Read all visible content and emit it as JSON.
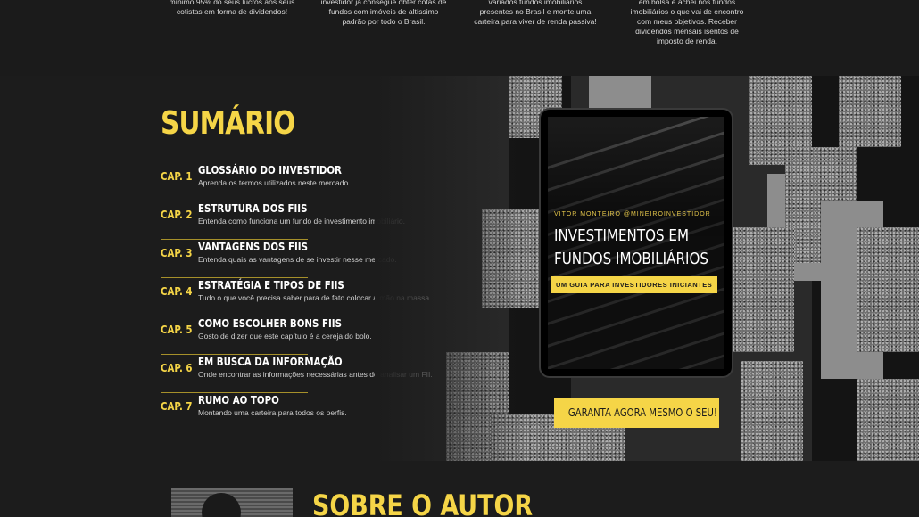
{
  "top_columns": [
    {
      "lines": [
        "mínimo 95% do seus lucros aos seus",
        "cotistas em forma de dividendos!"
      ]
    },
    {
      "lines": [
        "investidor já consegue obter cotas de",
        "fundos com imóveis de altíssimo",
        "padrão por todo o Brasil."
      ]
    },
    {
      "lines": [
        "variados fundos imobiliários",
        "presentes no Brasil e monte uma",
        "carteira para viver de renda passiva!"
      ]
    },
    {
      "lines": [
        "em bolsa e achei nos fundos",
        "imobiliários o que vai de encontro",
        "com meus objetivos. Receber",
        "dividendos mensais isentos de",
        "imposto de renda."
      ]
    }
  ],
  "sumario": {
    "title": "SUMÁRIO",
    "chapters": [
      {
        "cap": "CAP. 1",
        "name": "GLOSSÁRIO DO INVESTIDOR",
        "desc": "Aprenda os termos utilizados neste mercado."
      },
      {
        "cap": "CAP. 2",
        "name": "ESTRUTURA DOS FIIS",
        "desc": "Entenda como funciona um fundo de investimento imobiliário."
      },
      {
        "cap": "CAP. 3",
        "name": "VANTAGENS DOS FIIS",
        "desc": "Entenda quais as vantagens de se investir nesse mercado."
      },
      {
        "cap": "CAP. 4",
        "name": "ESTRATÉGIA E TIPOS DE FIIS",
        "desc": "Tudo o que você precisa saber para de fato colocar a mão na massa."
      },
      {
        "cap": "CAP. 5",
        "name": "COMO ESCOLHER BONS FIIS",
        "desc": "Gosto de dizer que este capítulo é a cereja do bolo."
      },
      {
        "cap": "CAP. 6",
        "name": "EM BUSCA DA INFORMAÇÃO",
        "desc": "Onde encontrar as informações necessárias antes de analisar um FII."
      },
      {
        "cap": "CAP. 7",
        "name": "RUMO AO TOPO",
        "desc": "Montando uma carteira para todos os perfis."
      }
    ]
  },
  "ebook": {
    "author_line": "VITOR MONTEIRO    @MINEIROINVESTIDOR",
    "title_line1": "INVESTIMENTOS EM",
    "title_line2": "FUNDOS IMOBILIÁRIOS",
    "subtitle": "UM GUIA PARA INVESTIDORES INICIANTES"
  },
  "cta": {
    "label": "GARANTA AGORA MESMO O SEU!"
  },
  "sobre": {
    "title": "SOBRE O AUTOR"
  },
  "colors": {
    "accent": "#f5d547",
    "background": "#1c1c1c"
  }
}
